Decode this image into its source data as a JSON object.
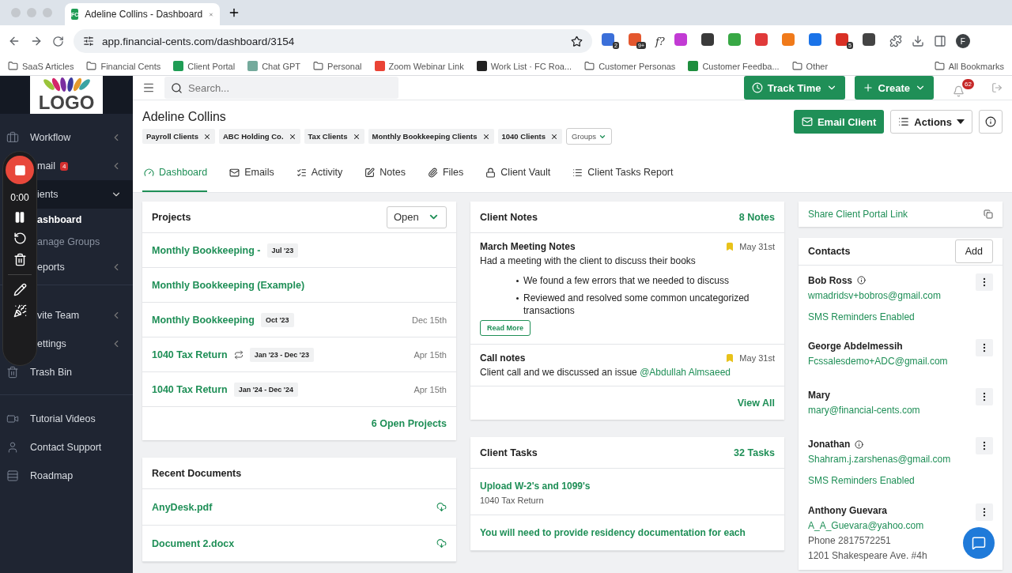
{
  "browser": {
    "tab_title": "Adeline Collins - Dashboard",
    "tab_favicon": "FC",
    "url": "app.financial-cents.com/dashboard/3154",
    "extensions": [
      {
        "badge": "2",
        "color": "#3b6fd9"
      },
      {
        "badge": "9+",
        "color": "#e4572e"
      },
      {
        "text": "f?"
      },
      {
        "color": "#c23bd4"
      },
      {
        "color": "#3a3a3a"
      },
      {
        "color": "#38a845"
      },
      {
        "color": "#e03a3a"
      },
      {
        "color": "#f07a1a"
      },
      {
        "color": "#1a73e8"
      },
      {
        "badge": "5",
        "color": "#d93025"
      },
      {
        "color": "#444444"
      }
    ],
    "profile": "F",
    "bookmarks": [
      {
        "label": "SaaS Articles",
        "kind": "folder"
      },
      {
        "label": "Financial Cents",
        "kind": "folder"
      },
      {
        "label": "Client Portal",
        "kind": "fc"
      },
      {
        "label": "Chat GPT",
        "kind": "gpt"
      },
      {
        "label": "Personal",
        "kind": "folder"
      },
      {
        "label": "Zoom Webinar Link",
        "kind": "gmail"
      },
      {
        "label": "Work List · FC Roa...",
        "kind": "github"
      },
      {
        "label": "Customer Personas",
        "kind": "folder"
      },
      {
        "label": "Customer Feedba...",
        "kind": "sheet"
      },
      {
        "label": "Other",
        "kind": "folder"
      }
    ],
    "all_bookmarks": "All Bookmarks"
  },
  "sidebar": {
    "logo": "LOGO",
    "items": [
      {
        "label": "Workflow",
        "expanded": false
      },
      {
        "label": "mail",
        "badge": "4",
        "expanded": false
      },
      {
        "label": "ients",
        "expanded": true,
        "selected": true,
        "children": [
          {
            "label": "ashboard",
            "selected": true
          },
          {
            "label": "anage Groups",
            "selected": false
          }
        ]
      },
      {
        "label": "eports",
        "expanded": false
      },
      {
        "label": "vite Team",
        "expanded": false
      },
      {
        "label": "ettings",
        "expanded": false
      },
      {
        "label": "Trash Bin"
      }
    ],
    "footer_items": [
      {
        "label": "Tutorial Videos"
      },
      {
        "label": "Contact Support"
      },
      {
        "label": "Roadmap"
      }
    ]
  },
  "recorder": {
    "timer": "0:00"
  },
  "topbar": {
    "search_placeholder": "Search...",
    "track_time": "Track Time",
    "create": "Create",
    "notifications": "62"
  },
  "client": {
    "name": "Adeline Collins",
    "groups": [
      "Payroll Clients",
      "ABC Holding Co.",
      "Tax Clients",
      "Monthly Bookkeeping Clients",
      "1040 Clients"
    ],
    "groups_button": "Groups",
    "email_button": "Email Client",
    "actions_button": "Actions",
    "tabs": [
      {
        "label": "Dashboard",
        "selected": true
      },
      {
        "label": "Emails",
        "selected": false
      },
      {
        "label": "Activity",
        "selected": false
      },
      {
        "label": "Notes",
        "selected": false
      },
      {
        "label": "Files",
        "selected": false
      },
      {
        "label": "Client Vault",
        "selected": false
      },
      {
        "label": "Client Tasks Report",
        "selected": false
      }
    ]
  },
  "projects": {
    "title": "Projects",
    "filter": "Open",
    "items": [
      {
        "name": "Monthly Bookkeeping -",
        "tag": "Jul '23"
      },
      {
        "name": "Monthly Bookkeeping (Example)"
      },
      {
        "name": "Monthly Bookkeeping",
        "tag": "Oct '23",
        "due": "Dec 15th"
      },
      {
        "name": "1040 Tax Return",
        "recurring": true,
        "tag": "Jan '23 - Dec '23",
        "due": "Apr 15th"
      },
      {
        "name": "1040 Tax Return",
        "tag": "Jan '24 - Dec '24",
        "due": "Apr 15th"
      }
    ],
    "footer": "6 Open Projects"
  },
  "notes": {
    "title": "Client Notes",
    "count": "8 Notes",
    "items": [
      {
        "title": "March Meeting Notes",
        "date": "May 31st",
        "body": "Had a meeting with the client to discuss their books",
        "bullets": [
          "We found a few errors that we needed to discuss",
          "Reviewed and resolved some common uncategorized transactions"
        ],
        "read_more": "Read More"
      },
      {
        "title": "Call notes",
        "date": "May 31st",
        "body": "Client call and we discussed an issue",
        "mention": "@Abdullah Almsaeed"
      }
    ],
    "footer": "View All"
  },
  "share_link": "Share Client Portal Link",
  "contacts": {
    "title": "Contacts",
    "add": "Add",
    "items": [
      {
        "name": "Bob Ross",
        "info": true,
        "email": "wmadridsv+bobros@gmail.com",
        "sms": "SMS Reminders Enabled"
      },
      {
        "name": "George Abdelmessih",
        "email": "Fcssalesdemo+ADC@gmail.com"
      },
      {
        "name": "Mary",
        "email": "mary@financial-cents.com"
      },
      {
        "name": "Jonathan",
        "info": true,
        "email": "Shahram.j.zarshenas@gmail.com",
        "sms": "SMS Reminders Enabled"
      },
      {
        "name": "Anthony Guevara",
        "email": "A_A_Guevara@yahoo.com",
        "phone": "Phone 2817572251",
        "address": "1201 Shakespeare Ave. #4h"
      }
    ]
  },
  "documents": {
    "title": "Recent Documents",
    "items": [
      "AnyDesk.pdf",
      "Document 2.docx"
    ]
  },
  "tasks": {
    "title": "Client Tasks",
    "count": "32 Tasks",
    "items": [
      {
        "title": "Upload W-2's and 1099's",
        "project": "1040 Tax Return"
      },
      {
        "title": "You will need to provide residency documentation for each"
      }
    ]
  }
}
